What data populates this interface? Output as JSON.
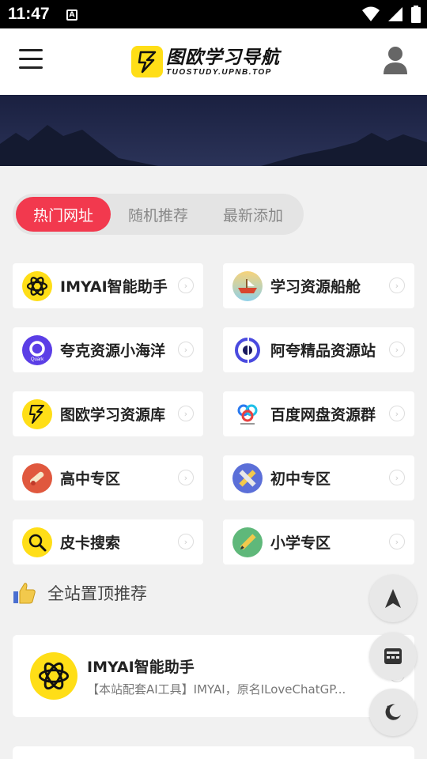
{
  "status_bar": {
    "time": "11:47",
    "notification_glyph": "A",
    "icons": [
      "wifi-icon",
      "signal-icon",
      "battery-icon"
    ]
  },
  "header": {
    "menu_icon": "hamburger-menu-icon",
    "logo_title": "图欧学习导航",
    "logo_subtitle": "TUOSTUDY.UPNB.TOP",
    "user_icon": "user-icon"
  },
  "tabs": [
    {
      "label": "热门网址",
      "active": true
    },
    {
      "label": "随机推荐",
      "active": false
    },
    {
      "label": "最新添加",
      "active": false
    }
  ],
  "sites": [
    {
      "label": "IMYAI智能助手",
      "icon": "openai-logo-icon"
    },
    {
      "label": "学习资源船舱",
      "icon": "ship-icon"
    },
    {
      "label": "夸克资源小海洋",
      "icon": "quark-icon"
    },
    {
      "label": "阿夸精品资源站",
      "icon": "akua-icon"
    },
    {
      "label": "图欧学习资源库",
      "icon": "tuo-lightning-icon"
    },
    {
      "label": "百度网盘资源群",
      "icon": "baidu-netdisk-icon"
    },
    {
      "label": "高中专区",
      "icon": "diploma-icon"
    },
    {
      "label": "初中专区",
      "icon": "ruler-pencil-icon"
    },
    {
      "label": "皮卡搜索",
      "icon": "search-magnifier-icon"
    },
    {
      "label": "小学专区",
      "icon": "pencil-icon"
    }
  ],
  "section": {
    "title": "全站置顶推荐",
    "icon": "thumbs-up-icon"
  },
  "featured": {
    "title": "IMYAI智能助手",
    "description": "【本站配套AI工具】IMYAI，原名ILoveChatGP..."
  },
  "colors": {
    "accent": "#f2394e",
    "brand_yellow": "#ffde17",
    "banner": "#1f2645"
  }
}
